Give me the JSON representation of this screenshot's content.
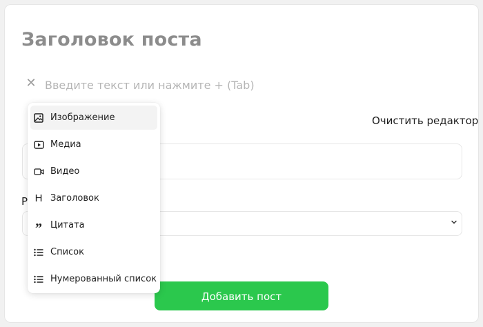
{
  "post": {
    "title_placeholder": "Заголовок поста",
    "editor_placeholder": "Введите текст или нажмите + (Tab)",
    "clear_editor_label": "Очистить редактор",
    "label_fragment": "Р",
    "submit_label": "Добавить пост",
    "submit_color": "#2bc84d"
  },
  "menu": {
    "items": [
      {
        "label": "Изображение",
        "icon": "image-icon"
      },
      {
        "label": "Медиа",
        "icon": "media-play-icon"
      },
      {
        "label": "Видео",
        "icon": "video-camera-icon"
      },
      {
        "label": "Заголовок",
        "icon": "heading-icon"
      },
      {
        "label": "Цитата",
        "icon": "quote-icon"
      },
      {
        "label": "Список",
        "icon": "bulleted-list-icon"
      },
      {
        "label": "Нумерованный список",
        "icon": "numbered-list-icon"
      }
    ]
  }
}
